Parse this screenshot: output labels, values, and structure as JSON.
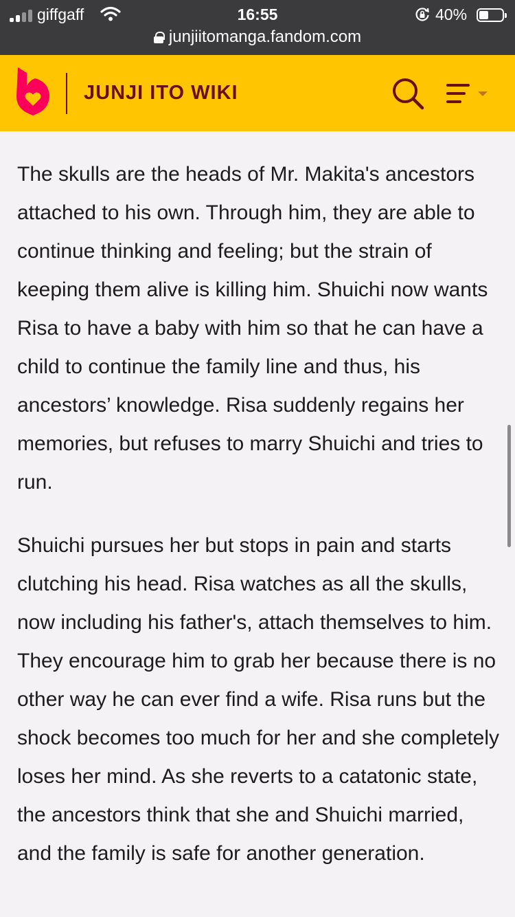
{
  "status_bar": {
    "carrier": "giffgaff",
    "time": "16:55",
    "battery_percent": "40%",
    "battery_level": 0.4,
    "url": "junjiitomanga.fandom.com"
  },
  "header": {
    "wiki_title": "JUNJI ITO WIKI",
    "colors": {
      "background": "#ffc500",
      "text": "#6a0f16",
      "logo": "#fa005a"
    },
    "icons": [
      "fandom-logo-icon",
      "search-icon",
      "menu-icon",
      "caret-down-icon"
    ]
  },
  "article": {
    "paragraphs": [
      "The skulls are the heads of Mr. Makita's ancestors attached to his own. Through him, they are able to continue thinking and feeling; but the strain of keeping them alive is killing him. Shuichi now wants Risa to have a baby with him so that he can have a child to continue the family line and thus, his ancestors’ knowledge. Risa suddenly regains her memories, but refuses to marry Shuichi and tries to run.",
      "Shuichi pursues her but stops in pain and starts clutching his head. Risa watches as all the skulls, now including his father's, attach themselves to him.  They encourage him to grab her because there is no other way he can ever find a wife. Risa runs but the shock becomes too much for her and she completely loses her mind. As she reverts to a catatonic state, the ancestors think that she and Shuichi married, and the family is safe for another generation."
    ]
  }
}
